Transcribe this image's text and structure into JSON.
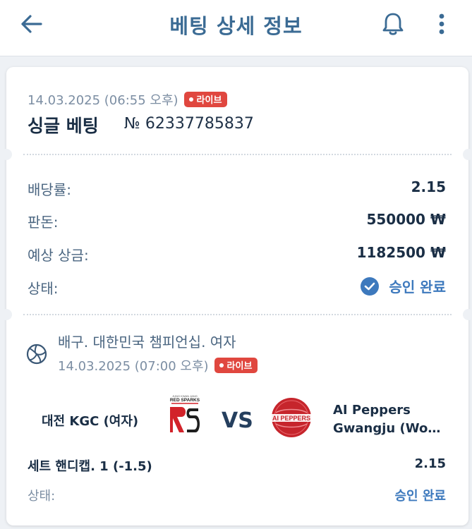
{
  "header": {
    "title": "베팅 상세 정보",
    "back_icon": "arrow-left-icon",
    "bell_icon": "bell-icon",
    "menu_icon": "more-vertical-icon"
  },
  "bet": {
    "date": "14.03.2025 (06:55 오후)",
    "live_label": "라이브",
    "type": "싱글 베팅",
    "number": "№ 62337785837"
  },
  "details": {
    "odds_label": "배당률:",
    "odds_value": "2.15",
    "stake_label": "판돈:",
    "stake_value": "550000 ₩",
    "payout_label": "예상 상금:",
    "payout_value": "1182500 ₩",
    "status_label": "상태:",
    "status_value": "승인 완료"
  },
  "event": {
    "league": "배구. 대한민국 챔피언십. 여자",
    "date": "14.03.2025 (07:00 오후)",
    "live_label": "라이브",
    "home_team": "대전 KGC (여자)",
    "home_logo_top": "JUNG KWAN JANG",
    "home_logo_name": "RED SPARKS",
    "vs": "VS",
    "away_logo_name": "AI PEPPERS",
    "away_team_line1": "AI Peppers",
    "away_team_line2": "Gwangju (Wom…",
    "market": "세트 핸디캡. 1 (-1.5)",
    "market_odds": "2.15",
    "status_label": "상태:",
    "status_value": "승인 완료"
  },
  "colors": {
    "accent": "#3d79bd",
    "title": "#3b6b94",
    "live": "#e0473f",
    "background": "#eef1f5"
  }
}
